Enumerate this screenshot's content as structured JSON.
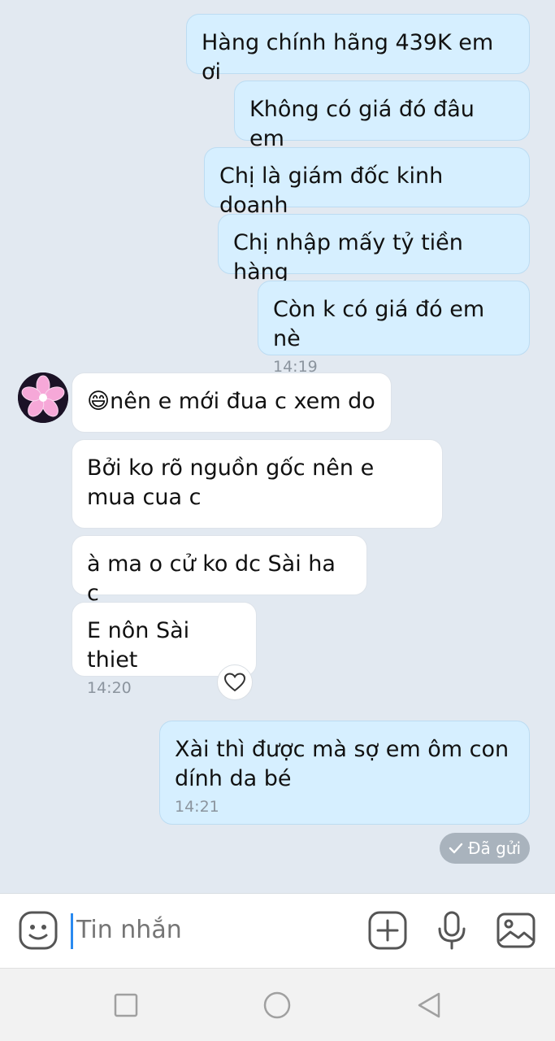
{
  "conversation": {
    "outgoing_1": [
      {
        "text": "Hàng chính hãng 439K em ơi",
        "time": ""
      },
      {
        "text": "Không có giá đó đâu em",
        "time": ""
      },
      {
        "text": "Chị là giám đốc kinh doanh",
        "time": ""
      },
      {
        "text": "Chị nhập mấy tỷ tiền hàng",
        "time": ""
      },
      {
        "text": "Còn k có giá đó em nè",
        "time": "14:19"
      }
    ],
    "incoming": [
      {
        "text": "😄nên e mới đua c xem do",
        "time": ""
      },
      {
        "text": "Bởi ko rõ nguồn gốc nên e mua cua c",
        "time": ""
      },
      {
        "text": "à ma o cử ko dc Sài ha c",
        "time": ""
      },
      {
        "text": "E nôn Sài thiet",
        "time": "14:20"
      }
    ],
    "outgoing_2": [
      {
        "text": "Xài thì được mà sợ em ôm con dính da bé",
        "time": "14:21"
      }
    ],
    "status": "Đã gửi"
  },
  "input": {
    "placeholder": "Tin nhắn"
  },
  "icons": {
    "emoji": "sticker-icon",
    "add": "plus-icon",
    "mic": "microphone-icon",
    "image": "image-icon",
    "reaction": "heart-icon",
    "sent": "check-icon",
    "nav_recent": "square-icon",
    "nav_home": "circle-icon",
    "nav_back": "triangle-back-icon"
  },
  "colors": {
    "chat_background": "#e2e9f1",
    "outgoing_bubble": "#d6efff",
    "incoming_bubble": "#ffffff",
    "cursor": "#2a8af0"
  }
}
